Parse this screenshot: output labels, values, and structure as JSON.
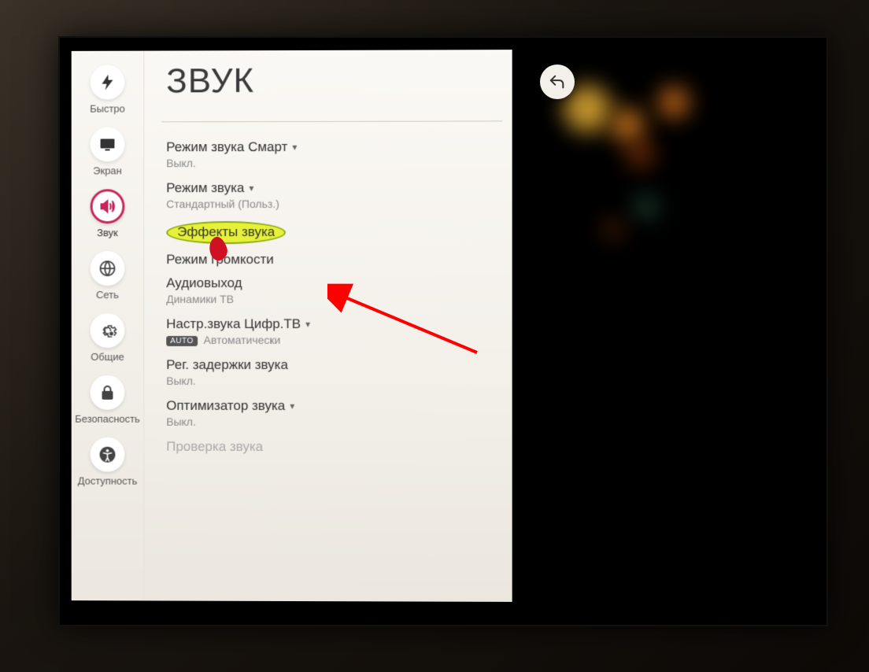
{
  "page": {
    "title": "ЗВУК"
  },
  "sidebar": {
    "items": [
      {
        "id": "quick",
        "label": "Быстро"
      },
      {
        "id": "screen",
        "label": "Экран"
      },
      {
        "id": "sound",
        "label": "Звук"
      },
      {
        "id": "network",
        "label": "Сеть"
      },
      {
        "id": "general",
        "label": "Общие"
      },
      {
        "id": "security",
        "label": "Безопасность"
      },
      {
        "id": "accessibility",
        "label": "Доступность"
      }
    ]
  },
  "menu": {
    "smart_mode": {
      "label": "Режим звука Смарт",
      "value": "Выкл."
    },
    "sound_mode": {
      "label": "Режим звука",
      "value": "Стандартный (Польз.)"
    },
    "effects": {
      "label": "Эффекты звука"
    },
    "loudness": {
      "label": "Режим громкости"
    },
    "output": {
      "label": "Аудиовыход",
      "value": "Динамики ТВ"
    },
    "digital": {
      "label": "Настр.звука Цифр.ТВ",
      "badge": "AUTO",
      "value": "Автоматически"
    },
    "delay": {
      "label": "Рег. задержки звука",
      "value": "Выкл."
    },
    "optimizer": {
      "label": "Оптимизатор звука",
      "value": "Выкл."
    },
    "test": {
      "label": "Проверка звука"
    }
  }
}
